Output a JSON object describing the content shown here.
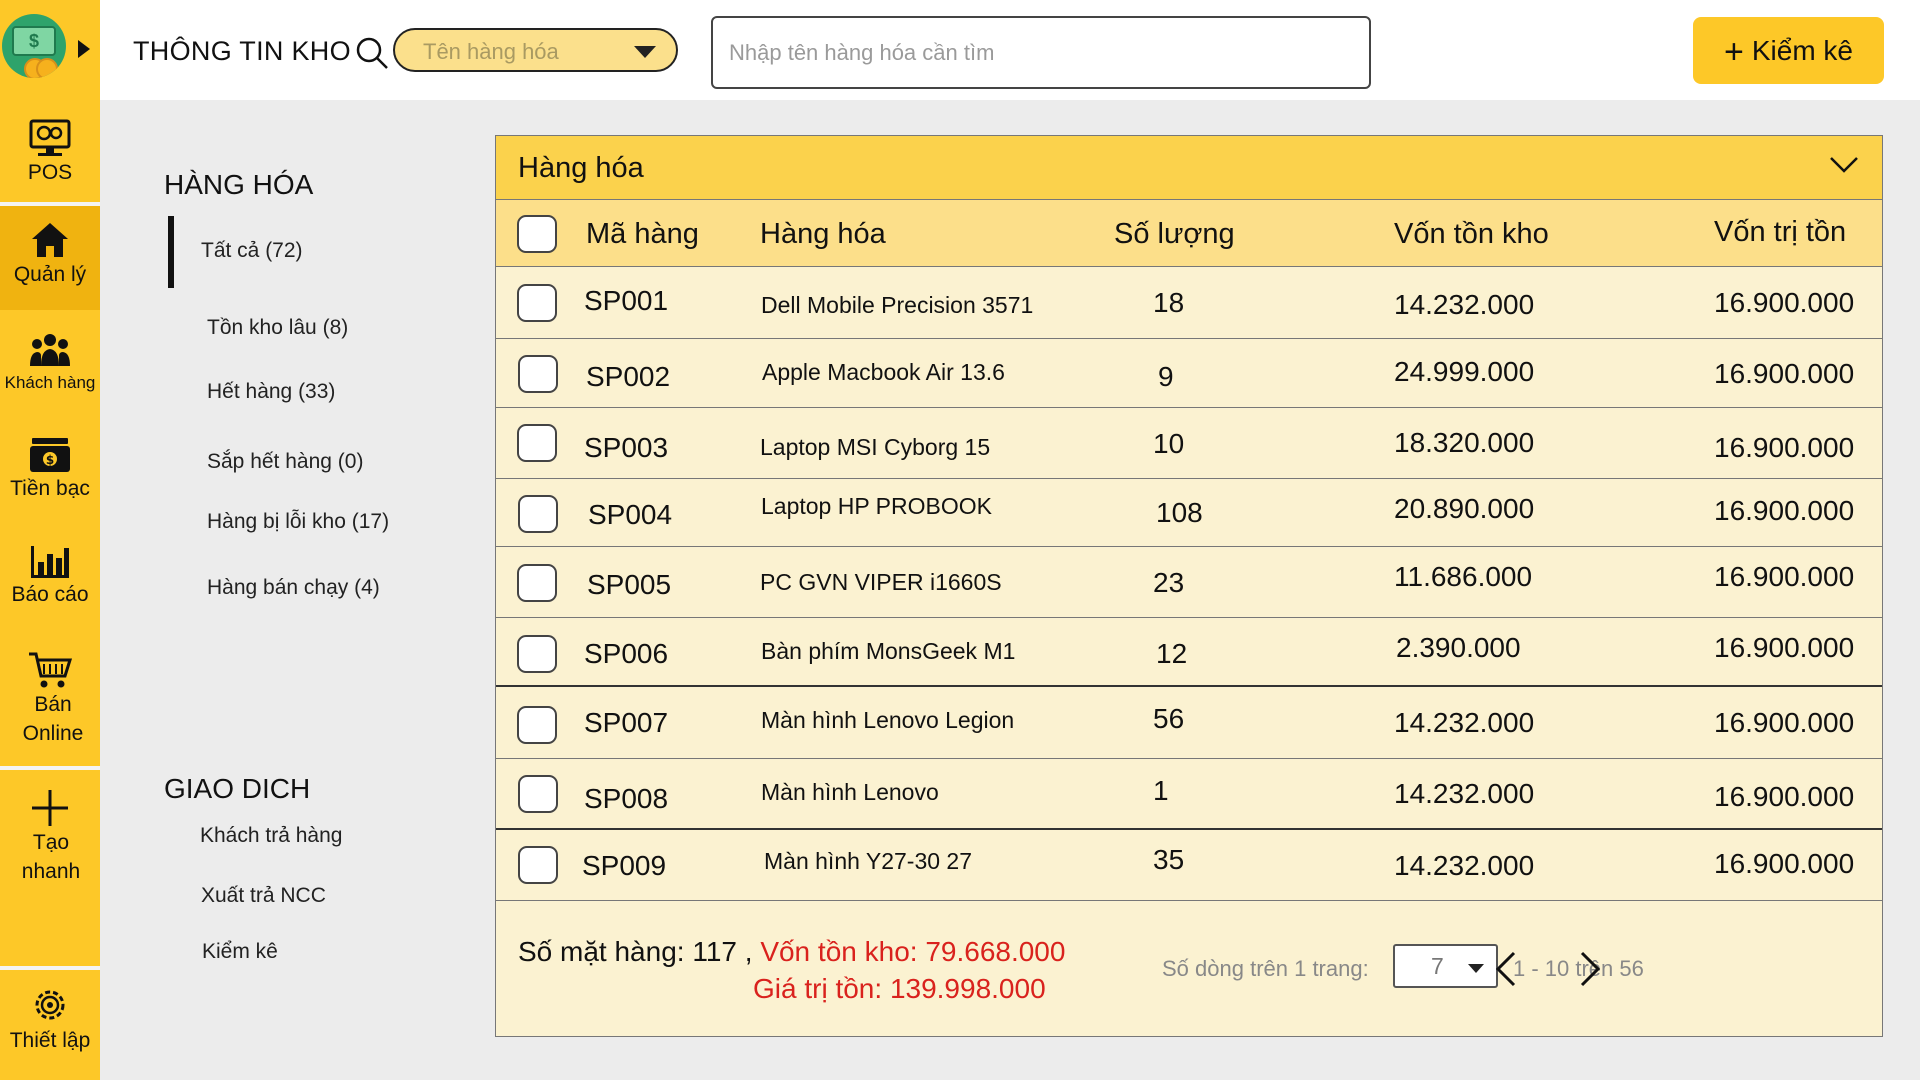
{
  "header": {
    "title": "THÔNG TIN KHO",
    "category_placeholder": "Tên hàng hóa",
    "search_placeholder": "Nhập tên hàng hóa cần tìm",
    "kiemke_label": "Kiểm kê",
    "logo_dollar": "$"
  },
  "sidebar": {
    "items": [
      {
        "label": "POS"
      },
      {
        "label": "Quản lý"
      },
      {
        "label": "Khách hàng"
      },
      {
        "label": "Tiền bạc"
      },
      {
        "label": "Báo cáo"
      },
      {
        "label": "Bán Online"
      },
      {
        "label": "Tạo nhanh"
      },
      {
        "label": "Thiết lập"
      }
    ],
    "active": "Quản lý"
  },
  "categories": {
    "goods_title": "HÀNG HÓA",
    "goods_items": [
      "Tất cả (72)",
      "Tồn kho lâu (8)",
      "Hết hàng (33)",
      "Sắp hết hàng (0)",
      "Hàng bị lỗi kho (17)",
      "Hàng bán chạy (4)"
    ],
    "trans_title": "GIAO DICH",
    "trans_items": [
      "Khách trả hàng",
      "Xuất trả NCC",
      "Kiểm kê"
    ]
  },
  "table": {
    "panel_title": "Hàng hóa",
    "columns": [
      "Mã hàng",
      "Hàng hóa",
      "Số lượng",
      "Vốn tồn kho",
      "Vốn trị tồn"
    ],
    "rows": [
      {
        "code": "SP001",
        "name": "Dell Mobile Precision 3571",
        "qty": "18",
        "stock_cost": "14.232.000",
        "value": "16.900.000"
      },
      {
        "code": "SP002",
        "name": "Apple Macbook Air 13.6",
        "qty": "9",
        "stock_cost": "24.999.000",
        "value": "16.900.000"
      },
      {
        "code": "SP003",
        "name": "Laptop MSI Cyborg 15",
        "qty": "10",
        "stock_cost": "18.320.000",
        "value": "16.900.000"
      },
      {
        "code": "SP004",
        "name": "Laptop HP PROBOOK",
        "qty": "108",
        "stock_cost": "20.890.000",
        "value": "16.900.000"
      },
      {
        "code": "SP005",
        "name": "PC GVN VIPER i1660S",
        "qty": "23",
        "stock_cost": "11.686.000",
        "value": "16.900.000"
      },
      {
        "code": "SP006",
        "name": "Bàn phím MonsGeek M1",
        "qty": "12",
        "stock_cost": "2.390.000",
        "value": "16.900.000"
      },
      {
        "code": "SP007",
        "name": "Màn hình Lenovo Legion",
        "qty": "56",
        "stock_cost": "14.232.000",
        "value": "16.900.000"
      },
      {
        "code": "SP008",
        "name": "Màn hình Lenovo",
        "qty": "1",
        "stock_cost": "14.232.000",
        "value": "16.900.000"
      },
      {
        "code": "SP009",
        "name": "Màn hình Y27-30 27",
        "qty": "35",
        "stock_cost": "14.232.000",
        "value": "16.900.000"
      }
    ]
  },
  "footer": {
    "count_text": "Số mặt hàng: 117 ,",
    "stock_cost_text": "Vốn tồn kho: 79.668.000",
    "value_text": "Giá trị tồn: 139.998.000",
    "rows_per_page_label": "Số dòng trên 1 trang:",
    "rows_per_page_value": "7",
    "range_text": "1 - 10 trên 56"
  },
  "colors": {
    "sidebar": "#fdc828",
    "panel_header": "#fbd24c",
    "row_bg": "#fbf2d1",
    "accent_red": "#d9221d"
  }
}
